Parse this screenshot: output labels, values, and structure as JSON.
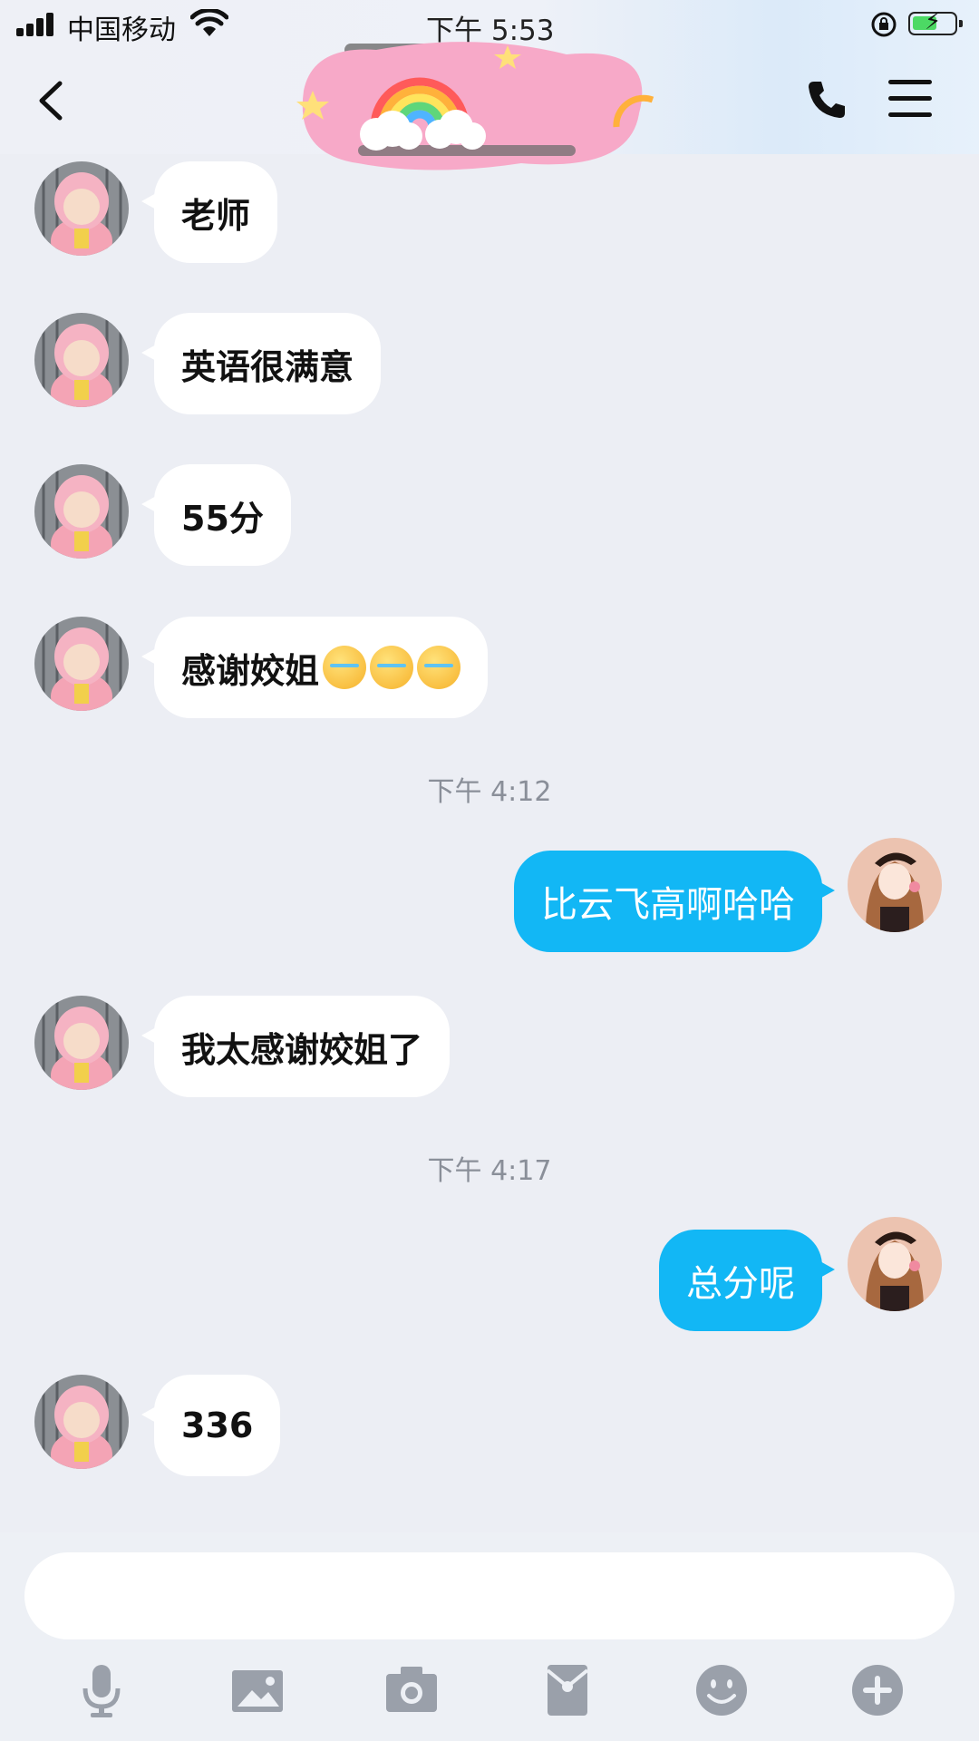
{
  "status_bar": {
    "carrier": "中国移动",
    "time": "下午 5:53"
  },
  "conversation": {
    "messages": [
      {
        "side": "in",
        "text": "老师"
      },
      {
        "side": "in",
        "text": "英语很满意"
      },
      {
        "side": "in",
        "text": "55分"
      },
      {
        "side": "in",
        "text": "感谢姣姐",
        "emoji_count": 3
      },
      {
        "type": "timestamp",
        "text": "下午 4:12"
      },
      {
        "side": "out",
        "text": "比云飞高啊哈哈"
      },
      {
        "side": "in",
        "text": "我太感谢姣姐了"
      },
      {
        "type": "timestamp",
        "text": "下午 4:17"
      },
      {
        "side": "out",
        "text": "总分呢"
      },
      {
        "side": "in",
        "text": "336"
      }
    ]
  },
  "icons": {
    "back": "chevron-left-icon",
    "call": "phone-icon",
    "menu": "hamburger-menu-icon",
    "toolbar": [
      "microphone-icon",
      "image-icon",
      "camera-icon",
      "red-packet-icon",
      "emoji-icon",
      "plus-icon"
    ]
  },
  "colors": {
    "outgoing_bubble": "#12b7f5",
    "incoming_bubble": "#ffffff",
    "background": "#eceef4",
    "toolbar_icon": "#9aa0aa"
  }
}
